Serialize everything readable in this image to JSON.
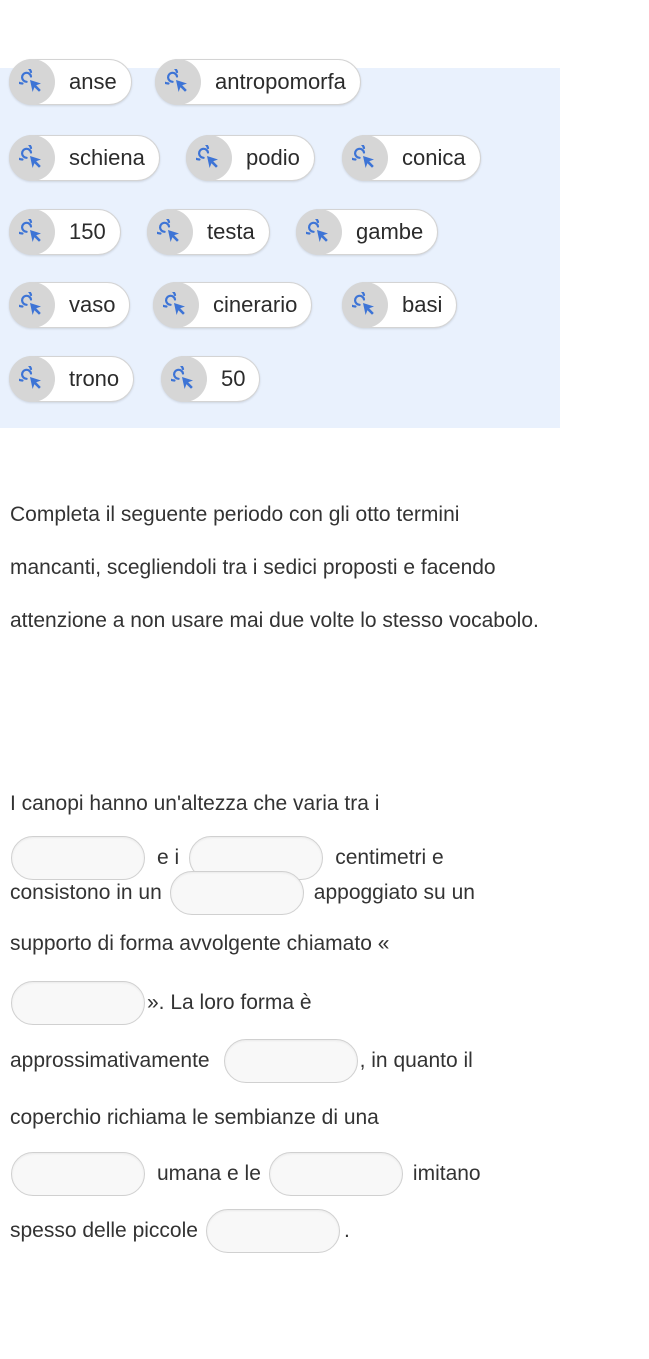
{
  "word_bank": {
    "chips": [
      {
        "label": "anse"
      },
      {
        "label": "antropomorfa"
      },
      {
        "label": "schiena"
      },
      {
        "label": "podio"
      },
      {
        "label": "conica"
      },
      {
        "label": "150"
      },
      {
        "label": "testa"
      },
      {
        "label": "gambe"
      },
      {
        "label": "vaso"
      },
      {
        "label": "cinerario"
      },
      {
        "label": "basi"
      },
      {
        "label": "trono"
      },
      {
        "label": "50"
      }
    ],
    "icon": "drag-cursor-icon",
    "accent_color": "#3d74d6"
  },
  "instructions": "Completa il seguente periodo con gli otto termini mancanti, scegliendoli tra i sedici proposti e facendo attenzione a non usare mai due volte lo stesso vocabolo.",
  "exercise": {
    "line1": "I canopi hanno un'altezza che varia tra i",
    "t_e_i": "e i",
    "t_centimetri_e": "centimetri e",
    "t_consistono": "consistono in un",
    "t_appoggiato": "appoggiato su un",
    "line4": "supporto di forma avvolgente chiamato «",
    "t_close_quote": "». La loro forma è",
    "t_approssimativamente": "approssimativamente",
    "t_in_quanto": ", in quanto il",
    "line8": "coperchio richiama le sembianze di una",
    "t_umana": "umana e le",
    "t_imitano": "imitano",
    "t_spesso": "spesso delle piccole",
    "t_period": "."
  }
}
